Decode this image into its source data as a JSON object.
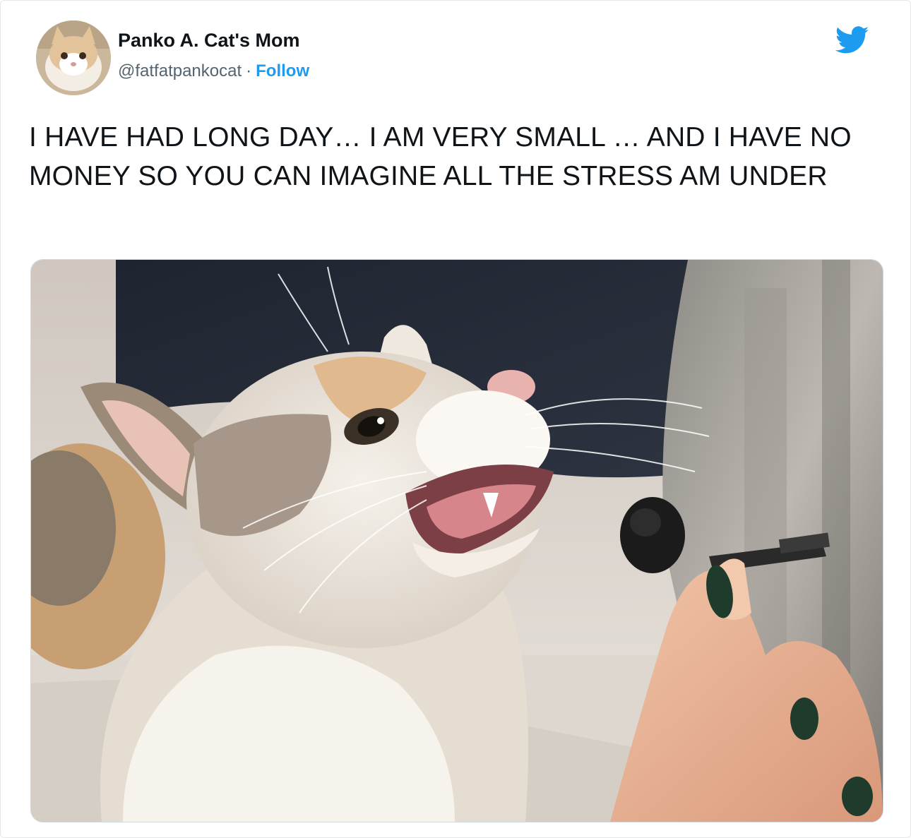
{
  "tweet": {
    "author": {
      "display_name": "Panko A. Cat's Mom",
      "handle": "@fatfatpankocat",
      "separator": "·",
      "follow_label": "Follow"
    },
    "text": "I HAVE HAD LONG DAY… I AM VERY SMALL … AND I HAVE NO MONEY SO YOU CAN IMAGINE ALL THE STRESS AM UNDER",
    "media": {
      "icon": "cat-photo-with-microphone"
    }
  },
  "colors": {
    "link": "#1d9bf0",
    "text": "#0f1419",
    "secondary": "#536471",
    "border": "#cfd9de"
  }
}
